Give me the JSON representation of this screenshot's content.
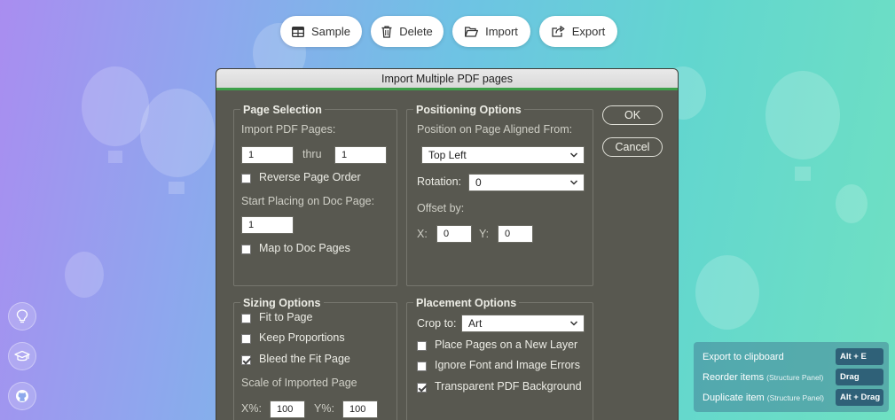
{
  "toolbar": {
    "sample": "Sample",
    "delete": "Delete",
    "import": "Import",
    "export": "Export"
  },
  "dialog": {
    "title": "Import Multiple PDF pages",
    "ok": "OK",
    "cancel": "Cancel",
    "page_selection": {
      "title": "Page Selection",
      "import_label": "Import PDF Pages:",
      "from_value": "1",
      "thru_label": "thru",
      "to_value": "1",
      "reverse_label": "Reverse Page Order",
      "reverse_checked": false,
      "start_label": "Start Placing on Doc Page:",
      "start_value": "1",
      "map_label": "Map to Doc Pages",
      "map_checked": false
    },
    "positioning": {
      "title": "Positioning Options",
      "position_label": "Position on Page Aligned From:",
      "position_value": "Top Left",
      "rotation_label": "Rotation:",
      "rotation_value": "0",
      "offset_label": "Offset by:",
      "x_label": "X:",
      "x_value": "0",
      "y_label": "Y:",
      "y_value": "0"
    },
    "sizing": {
      "title": "Sizing Options",
      "fit_label": "Fit to Page",
      "fit_checked": false,
      "keep_label": "Keep Proportions",
      "keep_checked": false,
      "bleed_label": "Bleed the Fit Page",
      "bleed_checked": true,
      "scale_label": "Scale of Imported Page",
      "xpct_label": "X%:",
      "xpct_value": "100",
      "ypct_label": "Y%:",
      "ypct_value": "100"
    },
    "placement": {
      "title": "Placement Options",
      "crop_label": "Crop to:",
      "crop_value": "Art",
      "new_layer_label": "Place Pages on a New Layer",
      "new_layer_checked": false,
      "ignore_label": "Ignore Font and Image Errors",
      "ignore_checked": false,
      "transparent_label": "Transparent PDF Background",
      "transparent_checked": true
    }
  },
  "side_buttons": [
    "lightbulb-icon",
    "graduation-cap-icon",
    "github-icon"
  ],
  "shortcuts": [
    {
      "text": "Export to clipboard",
      "sub": "",
      "key": "Alt + E"
    },
    {
      "text": "Reorder items",
      "sub": "(Structure Panel)",
      "key": "Drag"
    },
    {
      "text": "Duplicate item",
      "sub": "(Structure Panel)",
      "key": "Alt + Drag"
    }
  ],
  "colors": {
    "bg_start": "#a98df0",
    "bg_end": "#6fe0c2",
    "dialog_bg": "#585850",
    "title_accent": "#3ea04a",
    "shortcut_key": "#2f6178"
  }
}
